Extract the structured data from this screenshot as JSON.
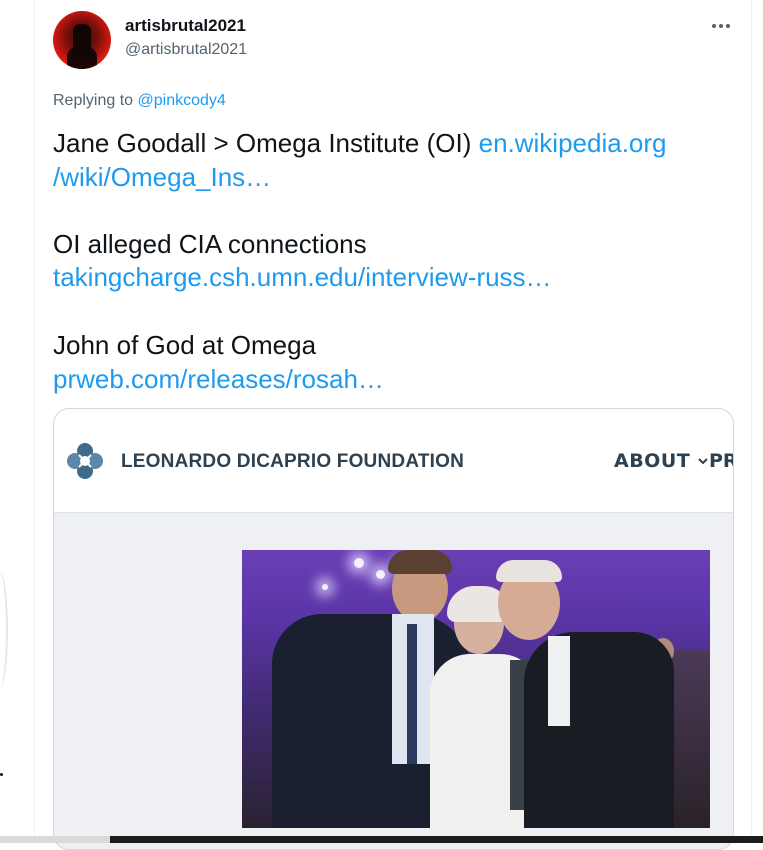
{
  "author": {
    "display_name": "artisbrutal2021",
    "handle": "@artisbrutal2021",
    "avatar_icon": "profile-avatar"
  },
  "more_icon": "more-horizontal-icon",
  "reply": {
    "prefix": "Replying to",
    "mention": "@pinkcody4"
  },
  "tweet": {
    "line1_text": "Jane Goodall > Omega Institute (OI) ",
    "line1_link": "en.wikipedia.org",
    "line2_link": "/wiki/Omega_Ins…",
    "line3_text": "OI alleged CIA connections",
    "line4_link": "takingcharge.csh.umn.edu/interview-russ…",
    "line5_text": "John of God at Omega",
    "line6_link": "prweb.com/releases/rosah…"
  },
  "card": {
    "site_title": "LEONARDO DICAPRIO FOUNDATION",
    "nav_item": "ABOUT",
    "nav_next_partial": "PRO",
    "logo_icon": "foundation-logo-icon"
  },
  "colors": {
    "link": "#1d9bf0",
    "secondary_text": "#536471",
    "primary_text": "#0f1419",
    "site_text": "#2e4150"
  }
}
